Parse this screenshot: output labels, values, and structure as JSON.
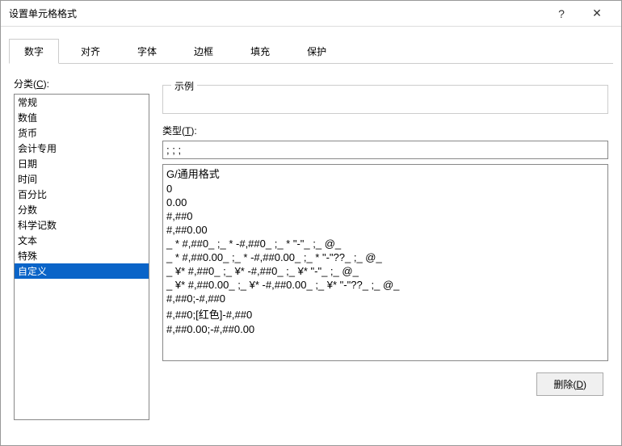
{
  "window": {
    "title": "设置单元格格式",
    "help_glyph": "?",
    "close_glyph": "✕"
  },
  "tabs": {
    "items": [
      {
        "label": "数字",
        "active": true
      },
      {
        "label": "对齐",
        "active": false
      },
      {
        "label": "字体",
        "active": false
      },
      {
        "label": "边框",
        "active": false
      },
      {
        "label": "填充",
        "active": false
      },
      {
        "label": "保护",
        "active": false
      }
    ]
  },
  "labels": {
    "category_prefix": "分类(",
    "category_key": "C",
    "category_suffix": "):",
    "example": "示例",
    "type_prefix": "类型(",
    "type_key": "T",
    "type_suffix": "):",
    "delete_prefix": "删除(",
    "delete_key": "D",
    "delete_suffix": ")"
  },
  "categories": {
    "items": [
      "常规",
      "数值",
      "货币",
      "会计专用",
      "日期",
      "时间",
      "百分比",
      "分数",
      "科学记数",
      "文本",
      "特殊",
      "自定义"
    ],
    "selected_index": 11
  },
  "type_value": "; ; ; ",
  "formats": {
    "items": [
      "G/通用格式",
      "0",
      "0.00",
      "#,##0",
      "#,##0.00",
      "_ * #,##0_ ;_ * -#,##0_ ;_ * \"-\"_ ;_ @_ ",
      "_ * #,##0.00_ ;_ * -#,##0.00_ ;_ * \"-\"??_ ;_ @_ ",
      "_ ¥* #,##0_ ;_ ¥* -#,##0_ ;_ ¥* \"-\"_ ;_ @_ ",
      "_ ¥* #,##0.00_ ;_ ¥* -#,##0.00_ ;_ ¥* \"-\"??_ ;_ @_ ",
      "#,##0;-#,##0",
      "#,##0;[红色]-#,##0",
      "#,##0.00;-#,##0.00"
    ]
  }
}
